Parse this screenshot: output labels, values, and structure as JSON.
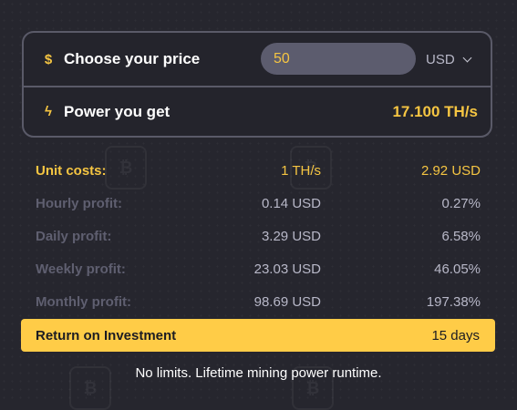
{
  "calculator": {
    "price_icon": "$",
    "price_label": "Choose your price",
    "price_value": "50",
    "currency": "USD",
    "power_icon": "ϟ",
    "power_label": "Power you get",
    "power_value": "17.100 TH/s"
  },
  "stats": [
    {
      "label": "Unit costs:",
      "mid": "1 TH/s",
      "right": "2.92 USD"
    },
    {
      "label": "Hourly profit:",
      "mid": "0.14 USD",
      "right": "0.27%"
    },
    {
      "label": "Daily profit:",
      "mid": "3.29 USD",
      "right": "6.58%"
    },
    {
      "label": "Weekly profit:",
      "mid": "23.03 USD",
      "right": "46.05%"
    },
    {
      "label": "Monthly profit:",
      "mid": "98.69 USD",
      "right": "197.38%"
    }
  ],
  "roi": {
    "label": "Return on Investment",
    "value": "15 days"
  },
  "footer": "No limits. Lifetime mining power runtime.",
  "colors": {
    "accent": "#ffcc47",
    "background": "#26262e",
    "muted": "#5f5f70"
  }
}
